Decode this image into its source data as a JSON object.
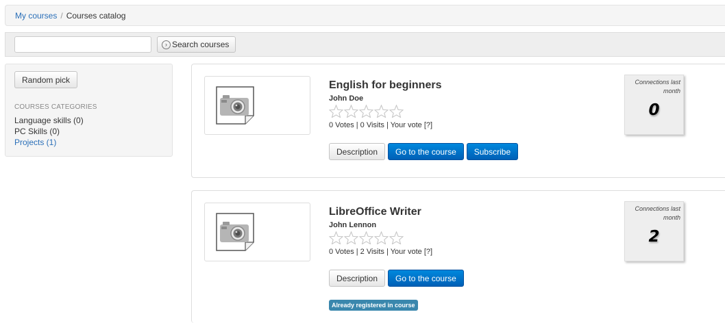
{
  "breadcrumb": {
    "link": "My courses",
    "separator": "/",
    "current": "Courses catalog"
  },
  "search": {
    "value": "",
    "placeholder": "",
    "button_label": "Search courses",
    "button_icon": "chevron-right-circle-icon"
  },
  "sidebar": {
    "random_label": "Random pick",
    "categories_title": "COURSES CATEGORIES",
    "categories": [
      {
        "label": "Language skills (0)"
      },
      {
        "label": "PC Skills (0)"
      },
      {
        "label": "Projects (1)"
      }
    ]
  },
  "courses": [
    {
      "title": "English for beginners",
      "teacher": "John Doe",
      "rating": 0,
      "rating_max": 5,
      "stats": "0 Votes | 0 Visits | Your vote [?]",
      "actions": {
        "description": "Description",
        "go": "Go to the course",
        "subscribe": "Subscribe"
      },
      "connections_label": "Connections last month",
      "connections_value": "0"
    },
    {
      "title": "LibreOffice Writer",
      "teacher": "John Lennon",
      "rating": 0,
      "rating_max": 5,
      "stats": "0 Votes | 2 Visits | Your vote [?]",
      "actions": {
        "description": "Description",
        "go": "Go to the course"
      },
      "badge": "Already registered in course",
      "connections_label": "Connections last month",
      "connections_value": "2"
    }
  ],
  "colors": {
    "link": "#2a6fb8",
    "primary": "#0070cc",
    "badge": "#3a87ad"
  }
}
